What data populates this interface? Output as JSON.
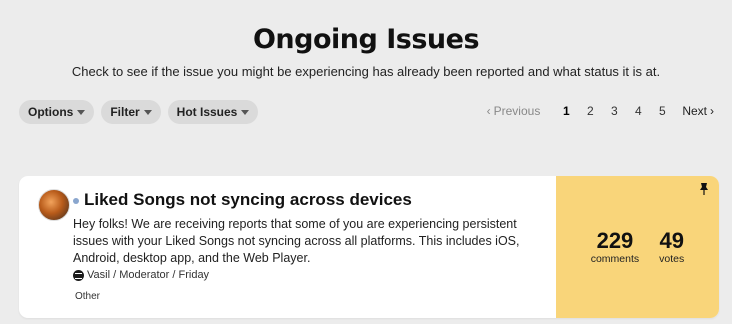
{
  "page": {
    "title": "Ongoing Issues",
    "subtitle": "Check to see if the issue you might be experiencing has already been reported and what status it is at."
  },
  "controls": {
    "options": "Options",
    "filter": "Filter",
    "hot_issues": "Hot Issues"
  },
  "pagination": {
    "previous": "Previous",
    "pages": [
      "1",
      "2",
      "3",
      "4",
      "5"
    ],
    "current": "1",
    "next": "Next"
  },
  "issue": {
    "title": "Liked Songs not syncing across devices",
    "body": "Hey folks! We are receiving reports that some of you are experiencing persistent issues with your Liked Songs not syncing across all platforms. This includes iOS, Android, desktop app, and the Web Player.",
    "author": "Vasil / Moderator / Friday",
    "tag": "Other",
    "comments": "229",
    "comments_label": "comments",
    "votes": "49",
    "votes_label": "votes"
  },
  "colors": {
    "stats_bg": "#f9d57a",
    "page_bg": "#ececec",
    "unread_dot": "#8aa6ce"
  }
}
